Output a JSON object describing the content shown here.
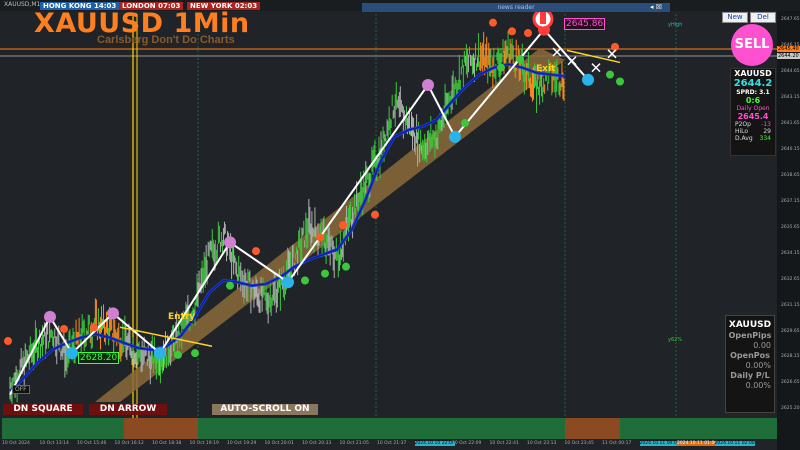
{
  "header": {
    "symbol_tag": "XAUUSD,M1",
    "sessions": {
      "hong_kong": "HONG KONG 14:03",
      "london": "LONDON 07:03",
      "new_york": "NEW YORK 02:03"
    },
    "news_label": "news reader",
    "title": "XAUUSD 1Min",
    "subtitle": "Carlsberg Don't Do Charts"
  },
  "buttons": {
    "new": "New",
    "del": "Del",
    "sell": "SELL",
    "dn_square": "DN SQUARE",
    "dn_arrow": "DN ARROW",
    "auto_scroll": "AUTO-SCROLL ON",
    "off": "OFF"
  },
  "info_panel": {
    "symbol": "XAUUSD",
    "price": "2644.2",
    "spread": "SPRD: 3.1",
    "ratio": "0:6",
    "daily_open_label": "Daily Open",
    "daily_open": "2645.4",
    "p2op_label": "P2Op",
    "p2op": "-13",
    "hilo_label": "HiLo",
    "hilo": "29",
    "davg_label": "D.Avg",
    "davg": "334"
  },
  "pl_panel": {
    "symbol": "XAUUSD",
    "open_pips_label": "OpenPips",
    "open_pips": "0.00",
    "open_pos_label": "OpenPos",
    "open_pos": "0.00%",
    "daily_pl_label": "Daily P/L",
    "daily_pl": "0.00%"
  },
  "annotations": {
    "entry": "Entry",
    "exit": "Exit",
    "low_price": "2628.20",
    "high_price": "2645.86",
    "yhigh": "yHigh",
    "y62": "y62%"
  },
  "colors": {
    "up": "#3cc83c",
    "down": "#b0b0b0",
    "ma": "#1e3cd8",
    "zigzag": "#ffffff",
    "channel": "#8b6a3a",
    "accent": "#ff7f1e"
  },
  "chart_data": {
    "type": "line",
    "title": "XAUUSD 1Min",
    "ylim": [
      2625,
      2648
    ],
    "y_ticks": [
      "2647.65",
      "2646.15",
      "2644.65",
      "2643.15",
      "2641.65",
      "2640.15",
      "2638.65",
      "2637.15",
      "2635.65",
      "2634.15",
      "2632.65",
      "2631.15",
      "2629.65",
      "2628.15",
      "2626.65",
      "2625.20"
    ],
    "right_tags": {
      "daily_open": "2645.40",
      "bid": "2644.20"
    },
    "x_ticks": [
      "10 Oct 2024",
      "10 Oct 13:14",
      "10 Oct 15:46",
      "10 Oct 16:12",
      "10 Oct 18:38",
      "10 Oct 19:19",
      "10 Oct 19:29",
      "10 Oct 20:01",
      "10 Oct 20:33",
      "10 Oct 21:05",
      "10 Oct 21:37",
      "2024.10.10 22:00",
      "10 Oct 22:09",
      "10 Oct 22:41",
      "10 Oct 23:13",
      "10 Oct 23:45",
      "11 Oct 00:17",
      "2024.10.11 00:00",
      "2024.10.11 01:00",
      "2024.10.11 02:00"
    ],
    "series": [
      {
        "name": "price",
        "values": [
          2626.4,
          2627.8,
          2629.0,
          2629.6,
          2628.2,
          2629.4,
          2630.1,
          2629.8,
          2629.1,
          2628.4,
          2628.0,
          2628.5,
          2629.6,
          2631.2,
          2634.0,
          2635.3,
          2633.0,
          2632.1,
          2631.4,
          2632.3,
          2633.8,
          2635.8,
          2635.0,
          2633.9,
          2636.4,
          2638.2,
          2640.0,
          2642.8,
          2641.7,
          2640.3,
          2641.0,
          2643.4,
          2645.1,
          2645.6,
          2645.0,
          2645.9,
          2644.9,
          2643.7,
          2644.4,
          2644.2
        ]
      },
      {
        "name": "ma",
        "values": [
          2626.2,
          2627.0,
          2627.9,
          2628.6,
          2629.0,
          2629.3,
          2629.5,
          2629.3,
          2629.0,
          2628.7,
          2628.6,
          2628.8,
          2629.4,
          2630.5,
          2631.9,
          2632.6,
          2632.5,
          2632.3,
          2632.4,
          2632.8,
          2633.4,
          2633.8,
          2634.1,
          2634.4,
          2635.5,
          2637.3,
          2639.4,
          2640.9,
          2641.3,
          2641.5,
          2641.9,
          2642.9,
          2643.8,
          2644.5,
          2644.9,
          2645.1,
          2644.9,
          2644.6,
          2644.5,
          2644.4
        ]
      },
      {
        "name": "zigzag",
        "values": [
          2626.0,
          2630.5,
          2628.4,
          2630.7,
          2628.4,
          2634.8,
          2632.5,
          2643.9,
          2640.9,
          2647.1,
          2644.2
        ]
      }
    ]
  }
}
